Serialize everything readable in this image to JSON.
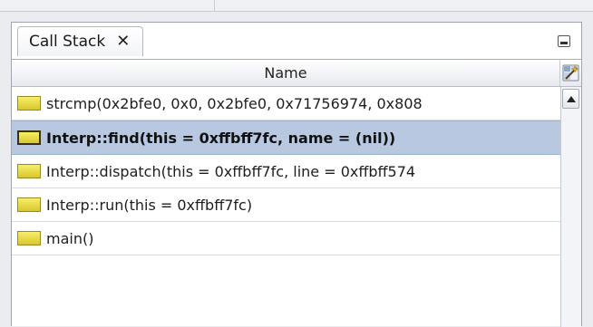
{
  "tab": {
    "label": "Call Stack",
    "close_glyph": "✕",
    "close_icon": "close-icon"
  },
  "panel": {
    "minimize_icon": "minimize-icon"
  },
  "table": {
    "column_header": "Name",
    "corner_icon": "column-chooser-icon",
    "rows": [
      {
        "text": "strcmp(0x2bfe0, 0x0, 0x2bfe0, 0x71756974, 0x808",
        "selected": false,
        "icon": "stack-frame-icon"
      },
      {
        "text": "Interp::find(this = 0xffbff7fc, name = (nil))",
        "selected": true,
        "icon": "stack-frame-icon"
      },
      {
        "text": "Interp::dispatch(this = 0xffbff7fc, line = 0xffbff574",
        "selected": false,
        "icon": "stack-frame-icon"
      },
      {
        "text": "Interp::run(this = 0xffbff7fc)",
        "selected": false,
        "icon": "stack-frame-icon"
      },
      {
        "text": "main()",
        "selected": false,
        "icon": "stack-frame-icon"
      }
    ]
  },
  "scrollbar": {
    "up_icon": "scroll-up-arrow-icon"
  },
  "colors": {
    "selection": "#b8c8e0",
    "frame_icon": "#e8dc40",
    "panel_border": "#9ea4b0"
  }
}
